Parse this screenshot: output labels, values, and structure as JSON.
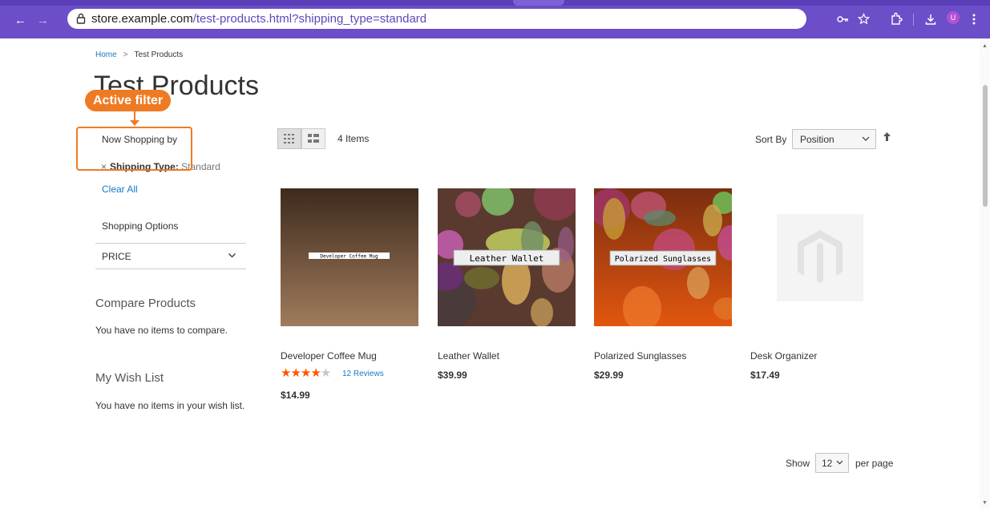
{
  "browser": {
    "back_icon": "←",
    "forward_icon": "→",
    "url_host": "store.example.com",
    "url_path": "/test-products.html?shipping_type=standard",
    "avatar_letter": "U",
    "accent": "#6b4ec8"
  },
  "breadcrumb": {
    "home": "Home",
    "separator": ">",
    "current": "Test Products"
  },
  "page": {
    "title": "Test Products"
  },
  "annotation": {
    "label": "Active filter",
    "color": "#ee7b24"
  },
  "sidebar": {
    "now_shopping_by": "Now Shopping by",
    "filter_remove_icon": "×",
    "filter_label": "Shipping Type:",
    "filter_value": "Standard",
    "clear_all": "Clear All",
    "shopping_options": "Shopping Options",
    "price_filter": "PRICE",
    "compare_title": "Compare Products",
    "compare_text": "You have no items to compare.",
    "wishlist_title": "My Wish List",
    "wishlist_text": "You have no items in your wish list."
  },
  "toolbar": {
    "amount": "4 Items",
    "sort_label": "Sort By",
    "sort_value": "Position",
    "show_label": "Show",
    "limit_value": "12",
    "per_page": "per page"
  },
  "products": [
    {
      "name": "Developer Coffee Mug",
      "image_text": "Developer Coffee Mug",
      "price": "$14.99",
      "rating_stars": 4,
      "reviews": "12  Reviews"
    },
    {
      "name": "Leather Wallet",
      "image_text": "Leather Wallet",
      "price": "$39.99"
    },
    {
      "name": "Polarized Sunglasses",
      "image_text": "Polarized Sunglasses",
      "price": "$29.99"
    },
    {
      "name": "Desk Organizer",
      "image_text": "",
      "price": "$17.49"
    }
  ]
}
